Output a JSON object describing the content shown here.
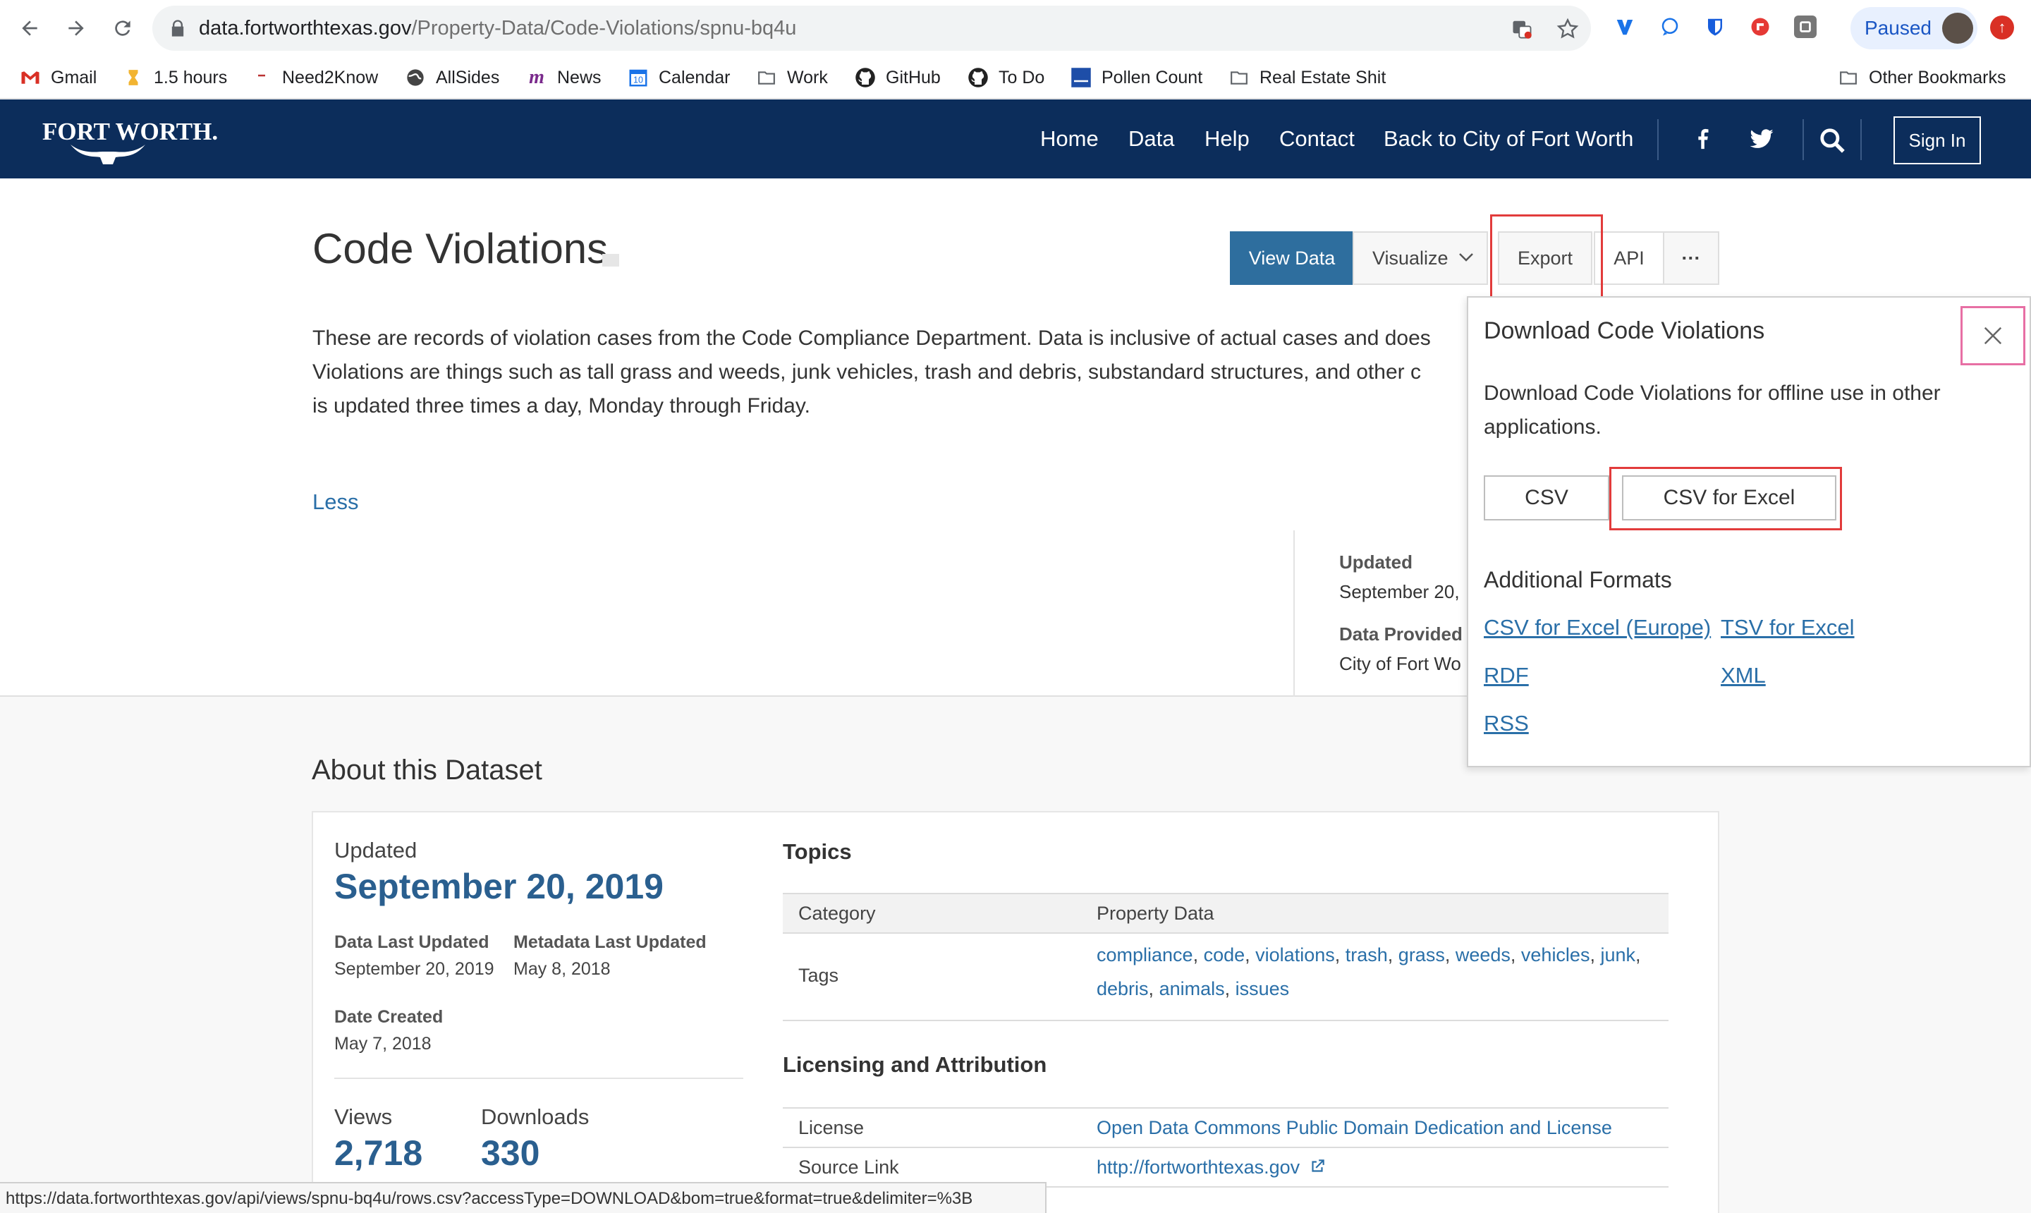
{
  "browser": {
    "url_host": "data.fortworthtexas.gov",
    "url_path": "/Property-Data/Code-Violations/spnu-bq4u",
    "profile_status": "Paused",
    "bookmarks": [
      {
        "label": "Gmail",
        "icon": "gmail-icon"
      },
      {
        "label": "1.5 hours",
        "icon": "hourglass-icon"
      },
      {
        "label": "Need2Know",
        "icon": "need2know-icon"
      },
      {
        "label": "AllSides",
        "icon": "globe-icon"
      },
      {
        "label": "News",
        "icon": "news-icon"
      },
      {
        "label": "Calendar",
        "icon": "calendar-icon",
        "badge": "10"
      },
      {
        "label": "Work",
        "icon": "folder-icon"
      },
      {
        "label": "GitHub",
        "icon": "github-icon"
      },
      {
        "label": "To Do",
        "icon": "github-icon"
      },
      {
        "label": "Pollen Count",
        "icon": "weather-channel-icon"
      },
      {
        "label": "Real Estate Shit",
        "icon": "folder-icon"
      },
      {
        "label": "Other Bookmarks",
        "icon": "folder-icon"
      }
    ],
    "status_url": "https://data.fortworthtexas.gov/api/views/spnu-bq4u/rows.csv?accessType=DOWNLOAD&bom=true&format=true&delimiter=%3B"
  },
  "site": {
    "logo_text": "FORT WORTH.",
    "nav": [
      "Home",
      "Data",
      "Help",
      "Contact",
      "Back to City of Fort Worth"
    ],
    "sign_in": "Sign In",
    "brand_color": "#0c2d5b"
  },
  "dataset": {
    "title": "Code Violations",
    "buttons": {
      "view_data": "View Data",
      "visualize": "Visualize",
      "export": "Export",
      "api": "API",
      "more": "···"
    },
    "description_lines": [
      "These are records of violation cases from the Code Compliance Department. Data is inclusive of actual cases and does",
      "Violations are things such as tall grass and weeds, junk vehicles, trash and debris, substandard structures, and other c",
      "is updated three times a day, Monday through Friday."
    ],
    "less": "Less",
    "meta": {
      "updated_label": "Updated",
      "updated_value": "September 20,",
      "provided_label": "Data Provided",
      "provided_value": "City of Fort Wo"
    }
  },
  "export_panel": {
    "title": "Download Code Violations",
    "description": "Download Code Violations for offline use in other applications.",
    "csv": "CSV",
    "csv_excel": "CSV for Excel",
    "additional_formats": "Additional Formats",
    "links": [
      "CSV for Excel (Europe)",
      "TSV for Excel",
      "RDF",
      "XML",
      "RSS"
    ]
  },
  "about": {
    "heading": "About this Dataset",
    "updated_label": "Updated",
    "updated_date": "September 20, 2019",
    "data_last_updated_label": "Data Last Updated",
    "data_last_updated": "September 20, 2019",
    "metadata_last_updated_label": "Metadata Last Updated",
    "metadata_last_updated": "May 8, 2018",
    "date_created_label": "Date Created",
    "date_created": "May 7, 2018",
    "views_label": "Views",
    "views": "2,718",
    "downloads_label": "Downloads",
    "downloads": "330",
    "topics_heading": "Topics",
    "category_label": "Category",
    "category_value": "Property Data",
    "tags_label": "Tags",
    "tags": [
      "compliance",
      "code",
      "violations",
      "trash",
      "grass",
      "weeds",
      "vehicles",
      "junk",
      "debris",
      "animals",
      "issues"
    ],
    "licensing_heading": "Licensing and Attribution",
    "license_label": "License",
    "license_value": "Open Data Commons Public Domain Dedication and License",
    "source_label": "Source Link",
    "source_value": "http://fortworthtexas.gov"
  }
}
